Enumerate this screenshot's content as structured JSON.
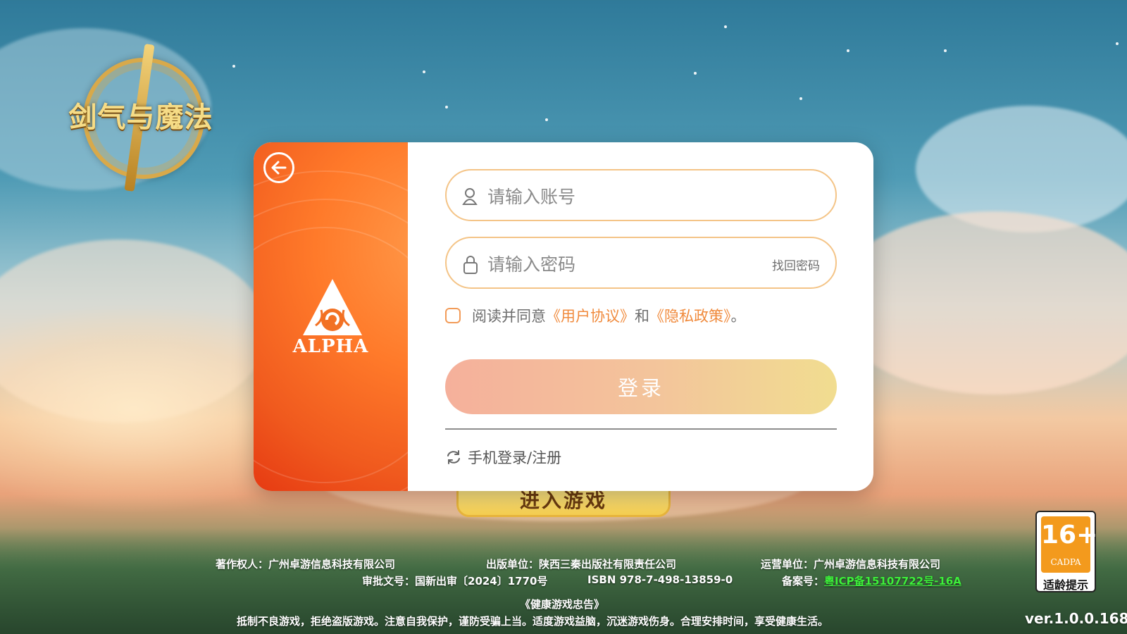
{
  "game_logo": {
    "title": "剑气与魔法"
  },
  "login": {
    "back_icon": "back-arrow-icon",
    "brand_name": "ALPHA",
    "account_placeholder": "请输入账号",
    "password_placeholder": "请输入密码",
    "forgot_password": "找回密码",
    "agree_prefix": "阅读并同意",
    "user_agreement": "《用户协议》",
    "and": "和",
    "privacy_policy": "《隐私政策》",
    "agree_suffix": "。",
    "login_button": "登录",
    "phone_login": "手机登录/注册",
    "accent_color": "#f08a3c"
  },
  "enter_game": {
    "label": "进入游戏"
  },
  "footer": {
    "copyright": "著作权人：广州卓游信息科技有限公司",
    "publisher": "出版单位：陕西三秦出版社有限责任公司",
    "operator": "运营单位：广州卓游信息科技有限公司",
    "approval": "审批文号：国新出审〔2024〕1770号",
    "isbn": "ISBN 978-7-498-13859-0",
    "icp_label": "备案号：",
    "icp_value": "粤ICP备15107722号-16A",
    "health_title": "《健康游戏忠告》",
    "health_text": "抵制不良游戏，拒绝盗版游戏。注意自我保护，谨防受骗上当。适度游戏益脑，沉迷游戏伤身。合理安排时间，享受健康生活。"
  },
  "age_rating": {
    "value": "16+",
    "org": "CADPA",
    "caption": "适龄提示"
  },
  "version": "ver.1.0.0.168"
}
